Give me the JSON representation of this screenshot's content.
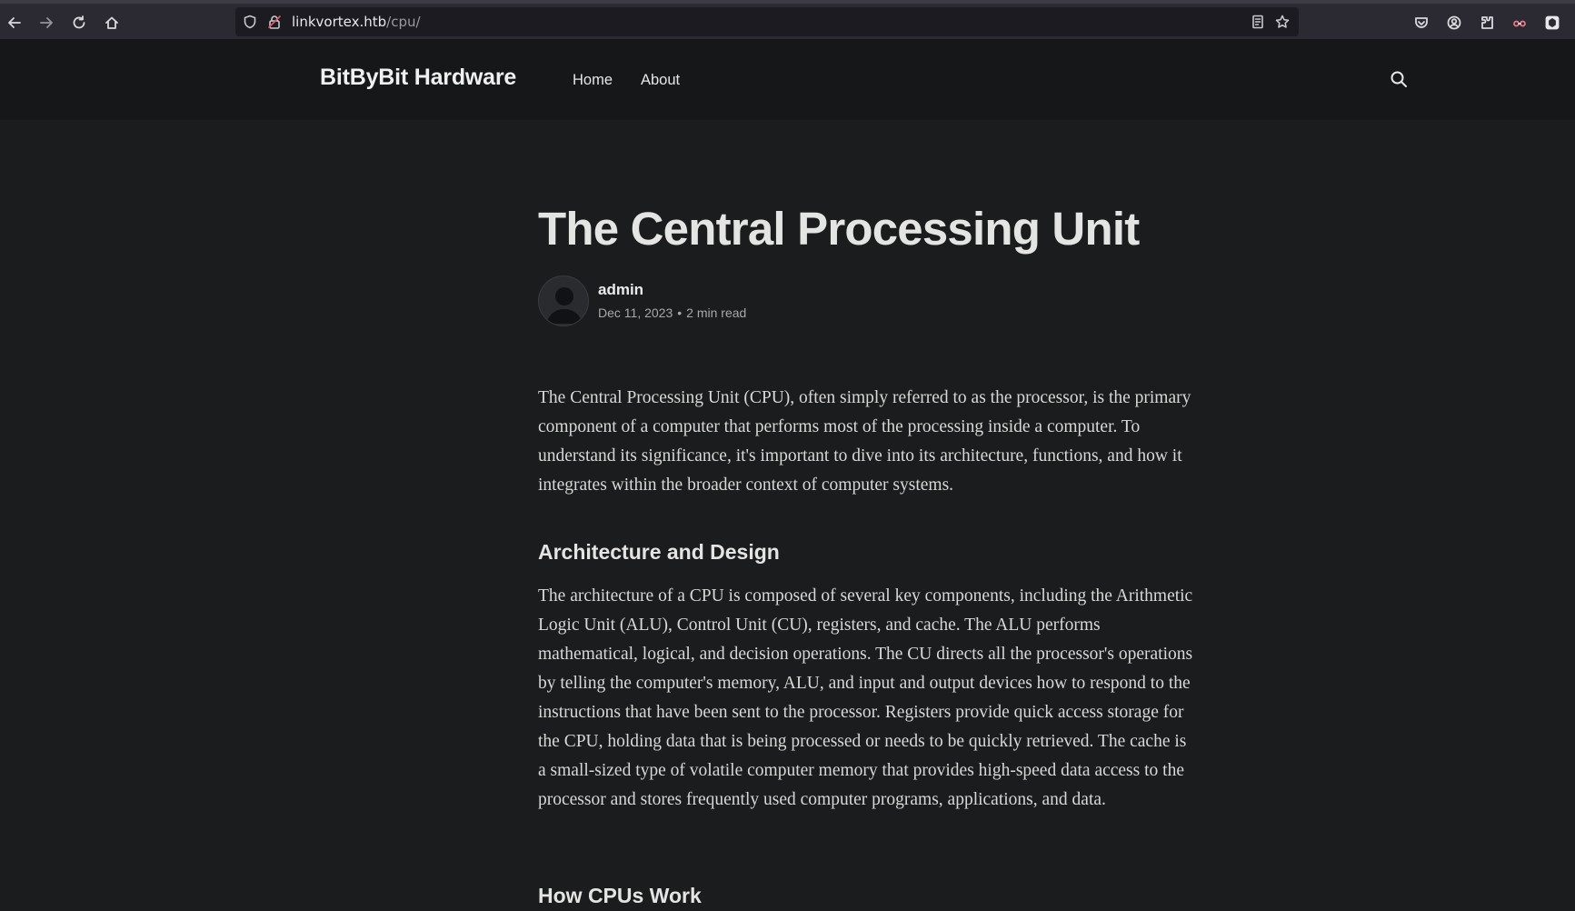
{
  "browser": {
    "url_host": "linkvortex.htb",
    "url_path": "/cpu/",
    "icons": [
      "back-icon",
      "forward-icon",
      "reload-icon",
      "home-icon",
      "shield-icon",
      "lock-icon",
      "reader-view-icon",
      "bookmark-star-icon",
      "pocket-icon",
      "account-icon",
      "extensions-icon",
      "glasses-extension-icon",
      "extension-icon"
    ]
  },
  "header": {
    "site_title": "BitByBit Hardware",
    "nav": [
      {
        "label": "Home"
      },
      {
        "label": "About"
      }
    ],
    "search_icon": "search-icon"
  },
  "post": {
    "title": "The Central Processing Unit",
    "author": "admin",
    "date": "Dec 11, 2023",
    "read_time": "2 min read",
    "paragraph_1": "The Central Processing Unit (CPU), often simply referred to as the processor, is the primary component of a computer that performs most of the processing inside a computer. To understand its significance, it's important to dive into its architecture, functions, and how it integrates within the broader context of computer systems.",
    "heading_1": "Architecture and Design",
    "paragraph_2": "The architecture of a CPU is composed of several key components, including the Arithmetic Logic Unit (ALU), Control Unit (CU), registers, and cache. The ALU performs mathematical, logical, and decision operations. The CU directs all the processor's operations by telling the computer's memory, ALU, and input and output devices how to respond to the instructions that have been sent to the processor. Registers provide quick access storage for the CPU, holding data that is being processed or needs to be quickly retrieved. The cache is a small-sized type of volatile computer memory that provides high-speed data access to the processor and stores frequently used computer programs, applications, and data.",
    "heading_2": "How CPUs Work"
  },
  "colors": {
    "page_bg": "#1b1c1e",
    "header_bg": "#161719",
    "browser_bg": "#2b2a33"
  }
}
